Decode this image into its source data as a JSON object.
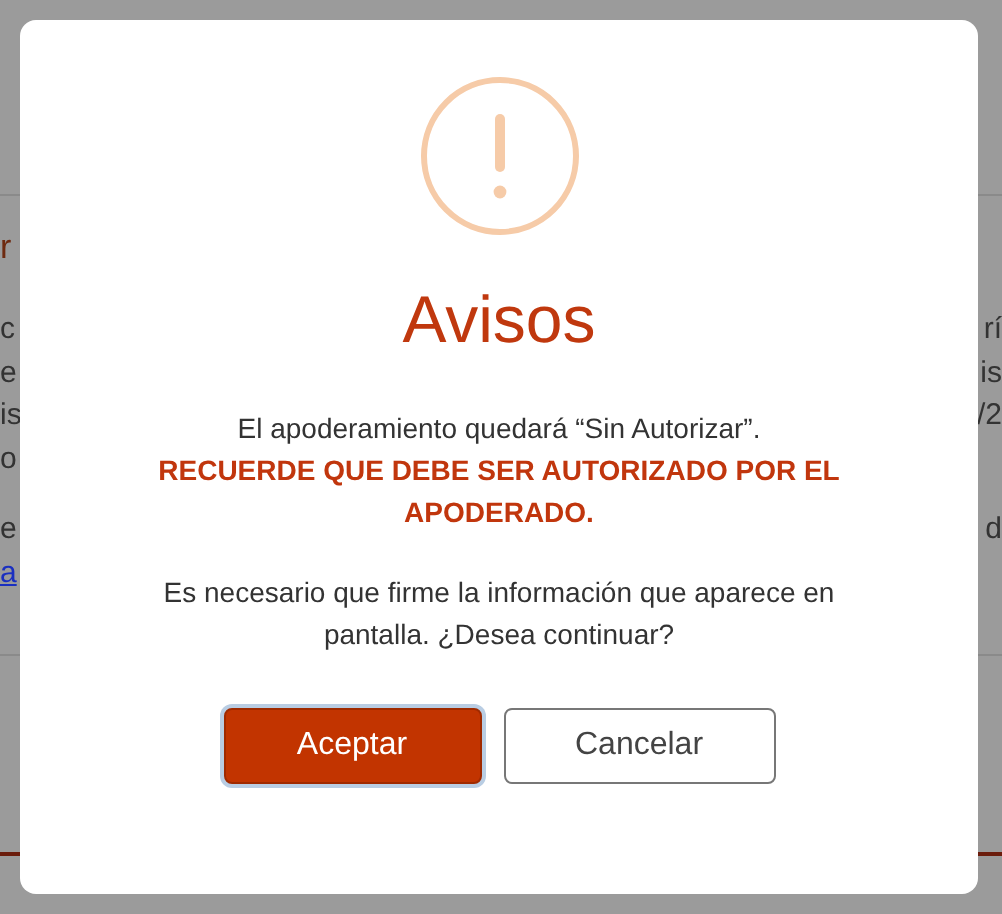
{
  "background": {
    "heading_fragment": "r",
    "paragraphs": [
      [
        {
          "left": "c",
          "right": "rí",
          "link": false
        },
        {
          "left": "e",
          "right": "is",
          "link": false
        },
        {
          "left": "is",
          "right": "/2",
          "link": false
        },
        {
          "left": "o",
          "link": false
        }
      ],
      [
        {
          "left": "e",
          "right": "d",
          "link": false
        },
        {
          "left": "a",
          "link": true
        }
      ]
    ]
  },
  "dialog": {
    "title": "Avisos",
    "messages": [
      {
        "kind": "normal",
        "text": "El apoderamiento quedará “Sin Autorizar”."
      },
      {
        "kind": "warning",
        "text": "RECUERDE QUE DEBE SER AUTORIZADO POR EL APODERADO."
      },
      {
        "kind": "normal",
        "text": "Es necesario que firme la información que aparece en pantalla. ¿Desea continuar?"
      }
    ],
    "buttons": [
      {
        "label": "Aceptar",
        "kind": "primary",
        "focused": true
      },
      {
        "label": "Cancelar",
        "kind": "secondary",
        "focused": false
      }
    ]
  }
}
